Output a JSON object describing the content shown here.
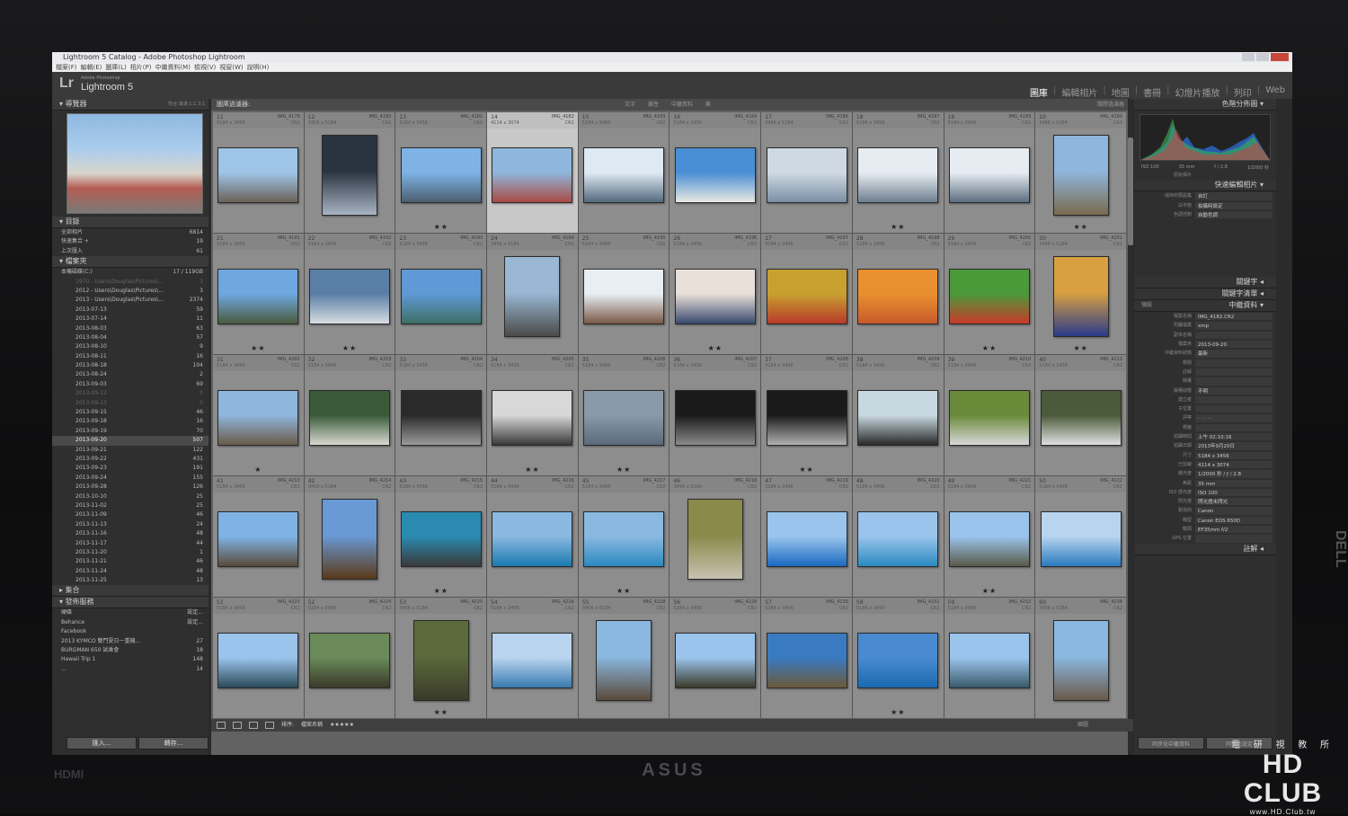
{
  "window": {
    "title": "Lightroom 5 Catalog - Adobe Photoshop Lightroom",
    "menu": [
      "檔案(F)",
      "編輯(E)",
      "圖庫(L)",
      "相片(P)",
      "中繼資料(M)",
      "檢視(V)",
      "視窗(W)",
      "說明(H)"
    ]
  },
  "header": {
    "logo": "Lr",
    "sub": "Adobe Photoshop",
    "app_name": "Lightroom 5",
    "modules": [
      {
        "label": "圖庫",
        "active": true
      },
      {
        "label": "編輯相片",
        "active": false
      },
      {
        "label": "地圖",
        "active": false
      },
      {
        "label": "書冊",
        "active": false
      },
      {
        "label": "幻燈片播放",
        "active": false
      },
      {
        "label": "列印",
        "active": false
      },
      {
        "label": "Web",
        "active": false
      }
    ]
  },
  "left": {
    "navigator_label": "導覽器",
    "navigator_opts": "符合  填滿  1:1  3:1",
    "catalog_label": "目錄",
    "catalog_items": [
      {
        "label": "全部相片",
        "count": "6814"
      },
      {
        "label": "快速集合 +",
        "count": "19"
      },
      {
        "label": "上次匯入",
        "count": "61"
      }
    ],
    "folders_label": "檔案夾",
    "volume": {
      "label": "本機磁碟(C:)",
      "count": "17 / 119GB"
    },
    "folders": [
      {
        "label": "1970 - Users\\Douglas\\Pictures\\...",
        "count": "3",
        "dim": true
      },
      {
        "label": "2012 - Users\\Douglas\\Pictures\\...",
        "count": "3",
        "dim": false
      },
      {
        "label": "2013 - Users\\Douglas\\Pictures\\...",
        "count": "2374",
        "dim": false
      },
      {
        "label": "2013-07-13",
        "count": "59"
      },
      {
        "label": "2013-07-14",
        "count": "11"
      },
      {
        "label": "2013-08-03",
        "count": "63"
      },
      {
        "label": "2013-08-04",
        "count": "57"
      },
      {
        "label": "2013-08-10",
        "count": "9"
      },
      {
        "label": "2013-08-11",
        "count": "16"
      },
      {
        "label": "2013-08-18",
        "count": "104"
      },
      {
        "label": "2013-08-24",
        "count": "2"
      },
      {
        "label": "2013-09-03",
        "count": "69"
      },
      {
        "label": "2013-09-12",
        "count": "0",
        "dim": true
      },
      {
        "label": "2013-09-13",
        "count": "0",
        "dim": true
      },
      {
        "label": "2013-09-15",
        "count": "46"
      },
      {
        "label": "2013-09-18",
        "count": "16"
      },
      {
        "label": "2013-09-19",
        "count": "70"
      },
      {
        "label": "2013-09-20",
        "count": "507",
        "sel": true
      },
      {
        "label": "2013-09-21",
        "count": "122"
      },
      {
        "label": "2013-09-22",
        "count": "431"
      },
      {
        "label": "2013-09-23",
        "count": "191"
      },
      {
        "label": "2013-09-24",
        "count": "155"
      },
      {
        "label": "2013-09-28",
        "count": "126"
      },
      {
        "label": "2013-10-10",
        "count": "25"
      },
      {
        "label": "2013-11-02",
        "count": "25"
      },
      {
        "label": "2013-11-09",
        "count": "46"
      },
      {
        "label": "2013-11-13",
        "count": "24"
      },
      {
        "label": "2013-11-16",
        "count": "48"
      },
      {
        "label": "2013-11-17",
        "count": "44"
      },
      {
        "label": "2013-11-20",
        "count": "1"
      },
      {
        "label": "2013-11-21",
        "count": "46"
      },
      {
        "label": "2013-11-24",
        "count": "48"
      },
      {
        "label": "2013-11-25",
        "count": "13"
      }
    ],
    "collections_label": "集合",
    "publish_label": "發佈服務",
    "publish_items": [
      {
        "label": "硬碟",
        "count": "設定..."
      },
      {
        "label": "Behance",
        "count": "設定..."
      },
      {
        "label": "Facebook",
        "count": ""
      },
      {
        "label": "2013 KYMCO 雙門夏日一重機...",
        "count": "27"
      },
      {
        "label": "BURGMAN 650 試乘會",
        "count": "18"
      },
      {
        "label": "Hawaii Trip 1",
        "count": "148"
      },
      {
        "label": "...",
        "count": "14"
      }
    ],
    "import_btn": "匯入...",
    "export_btn": "轉存..."
  },
  "center": {
    "filter_label": "圖庫過濾器:",
    "filter_opts": [
      "文字",
      "屬性",
      "中繼資料",
      "無"
    ],
    "preset": "關閉過濾器",
    "sort_label": "排序:",
    "sort_value": "檔案名稱",
    "toolbar_stars": "★★★★★",
    "toolbar_right": "縮圖",
    "photos": [
      {
        "n": "11",
        "name": "IMG_4179",
        "dim": "5184 x 3456",
        "ext": "CR2",
        "o": "land",
        "stars": "",
        "c1": "#9ec4e8",
        "c2": "#6b6258"
      },
      {
        "n": "12",
        "name": "IMG_4180",
        "dim": "3456 x 5184",
        "ext": "CR2",
        "o": "port",
        "stars": "",
        "c1": "#2a3340",
        "c2": "#a8b4c4"
      },
      {
        "n": "13",
        "name": "IMG_4181",
        "dim": "5184 x 3456",
        "ext": "CR2",
        "o": "land",
        "stars": "★★",
        "c1": "#7fb3e6",
        "c2": "#4a5e6e"
      },
      {
        "n": "14",
        "name": "IMG_4182",
        "dim": "4114 x 3074",
        "ext": "CR2",
        "o": "land",
        "stars": "",
        "c1": "#8fb6dc",
        "c2": "#a84a44",
        "sel": true
      },
      {
        "n": "15",
        "name": "IMG_4183",
        "dim": "5184 x 3456",
        "ext": "CR2",
        "o": "land",
        "stars": "",
        "c1": "#dfe9f3",
        "c2": "#536a7d"
      },
      {
        "n": "16",
        "name": "IMG_4184",
        "dim": "5184 x 3456",
        "ext": "CR2",
        "o": "land",
        "stars": "",
        "c1": "#4a8fd6",
        "c2": "#e8e8e0"
      },
      {
        "n": "17",
        "name": "IMG_4186",
        "dim": "3456 x 5184",
        "ext": "CR2",
        "o": "land",
        "stars": "",
        "c1": "#cfd9e3",
        "c2": "#7a8fa4"
      },
      {
        "n": "18",
        "name": "IMG_4187",
        "dim": "5184 x 3456",
        "ext": "CR2",
        "o": "land",
        "stars": "★★",
        "c1": "#e6ecf2",
        "c2": "#6f7f8e"
      },
      {
        "n": "19",
        "name": "IMG_4189",
        "dim": "5184 x 3456",
        "ext": "CR2",
        "o": "land",
        "stars": "",
        "c1": "#e6ecf2",
        "c2": "#5c6e80"
      },
      {
        "n": "20",
        "name": "IMG_4190",
        "dim": "3456 x 5184",
        "ext": "CR2",
        "o": "port",
        "stars": "★★",
        "c1": "#8fb6dc",
        "c2": "#7a6a4e"
      },
      {
        "n": "21",
        "name": "IMG_4191",
        "dim": "5184 x 3456",
        "ext": "CR2",
        "o": "land",
        "stars": "★★",
        "c1": "#6fa8e0",
        "c2": "#4a5a3e"
      },
      {
        "n": "22",
        "name": "IMG_4192",
        "dim": "5184 x 3456",
        "ext": "CR2",
        "o": "land",
        "stars": "★★",
        "c1": "#5a7fa6",
        "c2": "#d8dde2"
      },
      {
        "n": "23",
        "name": "IMG_4193",
        "dim": "5184 x 3456",
        "ext": "CR2",
        "o": "land",
        "stars": "",
        "c1": "#5f9ad6",
        "c2": "#3e6e66"
      },
      {
        "n": "24",
        "name": "IMG_4194",
        "dim": "3456 x 5184",
        "ext": "CR2",
        "o": "port",
        "stars": "",
        "c1": "#9ab8d4",
        "c2": "#4a4a48"
      },
      {
        "n": "25",
        "name": "IMG_4195",
        "dim": "5184 x 3456",
        "ext": "CR2",
        "o": "land",
        "stars": "",
        "c1": "#e8eef4",
        "c2": "#7a5a48"
      },
      {
        "n": "26",
        "name": "IMG_4196",
        "dim": "5184 x 3456",
        "ext": "CR2",
        "o": "land",
        "stars": "★★",
        "c1": "#e8e0d8",
        "c2": "#3a4a6e"
      },
      {
        "n": "27",
        "name": "IMG_4197",
        "dim": "5184 x 3456",
        "ext": "CR2",
        "o": "land",
        "stars": "",
        "c1": "#c8a030",
        "c2": "#b83a2a"
      },
      {
        "n": "28",
        "name": "IMG_4198",
        "dim": "5184 x 3456",
        "ext": "CR2",
        "o": "land",
        "stars": "",
        "c1": "#e89030",
        "c2": "#c85a2a"
      },
      {
        "n": "29",
        "name": "IMG_4200",
        "dim": "5184 x 3456",
        "ext": "CR2",
        "o": "land",
        "stars": "★★",
        "c1": "#4a9a3a",
        "c2": "#c83a2a"
      },
      {
        "n": "30",
        "name": "IMG_4201",
        "dim": "3456 x 5184",
        "ext": "CR2",
        "o": "port",
        "stars": "★★",
        "c1": "#d8a040",
        "c2": "#2a3a8a"
      },
      {
        "n": "31",
        "name": "IMG_4202",
        "dim": "5184 x 3456",
        "ext": "CR2",
        "o": "land",
        "stars": "★",
        "c1": "#8fb6dc",
        "c2": "#6a5a4a"
      },
      {
        "n": "32",
        "name": "IMG_4203",
        "dim": "5184 x 3456",
        "ext": "CR2",
        "o": "land",
        "stars": "",
        "c1": "#3a5a3a",
        "c2": "#d8d8d0"
      },
      {
        "n": "33",
        "name": "IMG_4204",
        "dim": "5184 x 3456",
        "ext": "CR2",
        "o": "land",
        "stars": "",
        "c1": "#2a2a2a",
        "c2": "#9a9a9a"
      },
      {
        "n": "34",
        "name": "IMG_4205",
        "dim": "5184 x 3456",
        "ext": "CR2",
        "o": "land",
        "stars": "★★",
        "c1": "#d8d8d8",
        "c2": "#3a3a3a"
      },
      {
        "n": "35",
        "name": "IMG_4206",
        "dim": "5184 x 3456",
        "ext": "CR2",
        "o": "land",
        "stars": "★★",
        "c1": "#8a9aaa",
        "c2": "#5a6a7a"
      },
      {
        "n": "36",
        "name": "IMG_4207",
        "dim": "5184 x 3456",
        "ext": "CR2",
        "o": "land",
        "stars": "",
        "c1": "#1a1a1a",
        "c2": "#8a8a8a"
      },
      {
        "n": "37",
        "name": "IMG_4208",
        "dim": "5184 x 3456",
        "ext": "CR2",
        "o": "land",
        "stars": "★★",
        "c1": "#1a1a1a",
        "c2": "#b0b0b0"
      },
      {
        "n": "38",
        "name": "IMG_4209",
        "dim": "5184 x 3456",
        "ext": "CR2",
        "o": "land",
        "stars": "",
        "c1": "#c8d8e0",
        "c2": "#2a2a2a"
      },
      {
        "n": "39",
        "name": "IMG_4210",
        "dim": "5184 x 3456",
        "ext": "CR2",
        "o": "land",
        "stars": "",
        "c1": "#6a8a3a",
        "c2": "#d8d8d8"
      },
      {
        "n": "40",
        "name": "IMG_4212",
        "dim": "5184 x 3456",
        "ext": "CR2",
        "o": "land",
        "stars": "",
        "c1": "#4a5a3a",
        "c2": "#e0e0e0"
      },
      {
        "n": "41",
        "name": "IMG_4213",
        "dim": "5184 x 3456",
        "ext": "CR2",
        "o": "land",
        "stars": "",
        "c1": "#7fb3e6",
        "c2": "#5a4a3a"
      },
      {
        "n": "42",
        "name": "IMG_4214",
        "dim": "3456 x 5184",
        "ext": "CR2",
        "o": "port",
        "stars": "",
        "c1": "#6a9ad6",
        "c2": "#5a3a1a"
      },
      {
        "n": "43",
        "name": "IMG_4215",
        "dim": "5184 x 3456",
        "ext": "CR2",
        "o": "land",
        "stars": "★★",
        "c1": "#2a8ab0",
        "c2": "#3a3a3a"
      },
      {
        "n": "44",
        "name": "IMG_4216",
        "dim": "5184 x 3456",
        "ext": "CR2",
        "o": "land",
        "stars": "",
        "c1": "#8ab8e0",
        "c2": "#1a7ab0"
      },
      {
        "n": "45",
        "name": "IMG_4217",
        "dim": "5184 x 3456",
        "ext": "CR2",
        "o": "land",
        "stars": "★★",
        "c1": "#8ab8e0",
        "c2": "#2a8ac0"
      },
      {
        "n": "46",
        "name": "IMG_4218",
        "dim": "3456 x 5184",
        "ext": "CR2",
        "o": "port",
        "stars": "",
        "c1": "#8a8a4a",
        "c2": "#c8c0b0"
      },
      {
        "n": "47",
        "name": "IMG_4219",
        "dim": "5184 x 3456",
        "ext": "CR2",
        "o": "land",
        "stars": "",
        "c1": "#9ac4ec",
        "c2": "#1a6ac0"
      },
      {
        "n": "48",
        "name": "IMG_4220",
        "dim": "5184 x 3456",
        "ext": "CR2",
        "o": "land",
        "stars": "",
        "c1": "#9ac4ec",
        "c2": "#2a8ac0"
      },
      {
        "n": "49",
        "name": "IMG_4221",
        "dim": "5184 x 3456",
        "ext": "CR2",
        "o": "land",
        "stars": "★★",
        "c1": "#9ac4ec",
        "c2": "#5a5a4a"
      },
      {
        "n": "50",
        "name": "IMG_4222",
        "dim": "5184 x 3456",
        "ext": "CR2",
        "o": "land",
        "stars": "",
        "c1": "#b8d4ee",
        "c2": "#2a7ac0"
      },
      {
        "n": "51",
        "name": "IMG_4223",
        "dim": "5184 x 3456",
        "ext": "CR2",
        "o": "land",
        "stars": "",
        "c1": "#9ac4ec",
        "c2": "#2a4a5a"
      },
      {
        "n": "52",
        "name": "IMG_4224",
        "dim": "5184 x 3456",
        "ext": "CR2",
        "o": "land",
        "stars": "",
        "c1": "#6a8a5a",
        "c2": "#3a3a2a"
      },
      {
        "n": "53",
        "name": "IMG_4225",
        "dim": "3456 x 5184",
        "ext": "CR2",
        "o": "port",
        "stars": "★★",
        "c1": "#5a6a3a",
        "c2": "#3a3a2a"
      },
      {
        "n": "54",
        "name": "IMG_4226",
        "dim": "5184 x 3456",
        "ext": "CR2",
        "o": "land",
        "stars": "",
        "c1": "#b8d4ee",
        "c2": "#3a7ab0"
      },
      {
        "n": "55",
        "name": "IMG_4228",
        "dim": "3456 x 5184",
        "ext": "CR2",
        "o": "port",
        "stars": "",
        "c1": "#8ab8e0",
        "c2": "#5a4a3a"
      },
      {
        "n": "56",
        "name": "IMG_4229",
        "dim": "5184 x 3456",
        "ext": "CR2",
        "o": "land",
        "stars": "",
        "c1": "#9ac4ec",
        "c2": "#3a3a2a"
      },
      {
        "n": "57",
        "name": "IMG_4230",
        "dim": "5184 x 3456",
        "ext": "CR2",
        "o": "land",
        "stars": "",
        "c1": "#3a7ac0",
        "c2": "#6a5a3a"
      },
      {
        "n": "58",
        "name": "IMG_4231",
        "dim": "5184 x 3456",
        "ext": "CR2",
        "o": "land",
        "stars": "★★",
        "c1": "#4a8ad0",
        "c2": "#1a6ab0"
      },
      {
        "n": "59",
        "name": "IMG_4232",
        "dim": "5184 x 3456",
        "ext": "CR2",
        "o": "land",
        "stars": "",
        "c1": "#9ac4ec",
        "c2": "#3a5a6a"
      },
      {
        "n": "60",
        "name": "IMG_4236",
        "dim": "3456 x 5184",
        "ext": "CR2",
        "o": "port",
        "stars": "",
        "c1": "#8ab8e0",
        "c2": "#6a5a4a"
      }
    ]
  },
  "right": {
    "histogram_label": "色階分佈圖",
    "histo_info": [
      "ISO 100",
      "35 mm",
      "f / 2.8",
      "1/2000 秒"
    ],
    "original_photo": "原始相片",
    "quick_develop_label": "快速編輯相片",
    "quick_develop": [
      {
        "k": "儲存的預設集",
        "v": "自訂"
      },
      {
        "k": "白平衡",
        "v": "拍攝時設定"
      },
      {
        "k": "色調控制",
        "v": "自動色調"
      }
    ],
    "keywords_label": "關鍵字",
    "keyword_list_label": "關鍵字清單",
    "metadata_label": "中繼資料",
    "metadata_preset": "預設",
    "metadata": [
      {
        "k": "檔案名稱",
        "v": "IMG_4182.CR2"
      },
      {
        "k": "附屬檔案",
        "v": "xmp"
      },
      {
        "k": "副本名稱",
        "v": ""
      },
      {
        "k": "檔案夾",
        "v": "2013-09-20"
      },
      {
        "k": "中繼資料狀態",
        "v": "最新"
      },
      {
        "k": "標題",
        "v": ""
      },
      {
        "k": "註解",
        "v": ""
      },
      {
        "k": "版權",
        "v": ""
      },
      {
        "k": "版權狀態",
        "v": "不明"
      },
      {
        "k": "建立者",
        "v": ""
      },
      {
        "k": "子位置",
        "v": ""
      },
      {
        "k": "評等",
        "v": "· · · · ·"
      },
      {
        "k": "標籤",
        "v": ""
      },
      {
        "k": "拍攝時間",
        "v": "上午 02:10:16"
      },
      {
        "k": "拍攝日期",
        "v": "2013年9月20日"
      },
      {
        "k": "尺寸",
        "v": "5184 x 3456"
      },
      {
        "k": "已剪裁",
        "v": "4114 x 3074"
      },
      {
        "k": "曝光度",
        "v": "1/2000 秒 / ƒ / 2.8"
      },
      {
        "k": "焦距",
        "v": "35 mm"
      },
      {
        "k": "ISO 感光度",
        "v": "ISO 100"
      },
      {
        "k": "閃光燈",
        "v": "閃光燈未閃光"
      },
      {
        "k": "製造商",
        "v": "Canon"
      },
      {
        "k": "機型",
        "v": "Canon EOS 650D"
      },
      {
        "k": "鏡頭",
        "v": "EF35mm f/2"
      },
      {
        "k": "GPS 位置",
        "v": ""
      }
    ],
    "comments_label": "註解",
    "sync_btn": "同步化中繼資料",
    "sync_settings_btn": "同步化設定"
  },
  "watermark": {
    "top": "電 研 視 教 所",
    "logo": "HD CLUB",
    "url": "www.HD.Club.tw"
  },
  "bezel": {
    "brand": "ASUS",
    "hdmi": "HDMI",
    "side": "DELL"
  }
}
